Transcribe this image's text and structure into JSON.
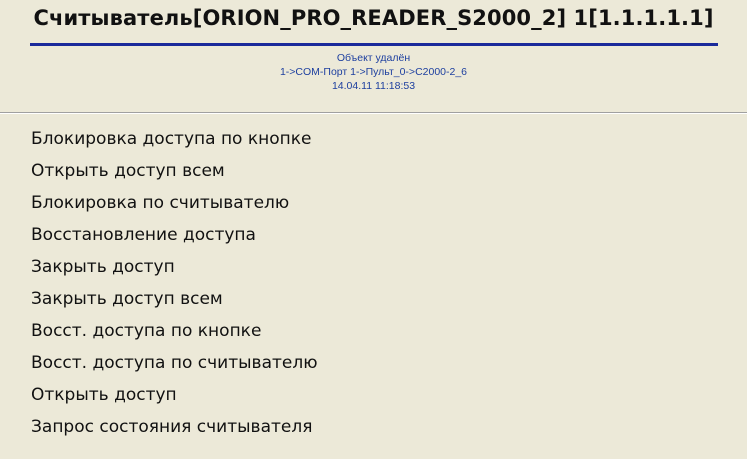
{
  "header": {
    "title": "Считыватель[ORION_PRO_READER_S2000_2] 1[1.1.1.1.1]",
    "status": "Объект удалён",
    "path": "1->COM-Порт 1->Пульт_0->С2000-2_6",
    "timestamp": "14.04.11 11:18:53"
  },
  "menu": {
    "items": [
      {
        "label": "Блокировка доступа по кнопке"
      },
      {
        "label": "Открыть доступ всем"
      },
      {
        "label": "Блокировка по считывателю"
      },
      {
        "label": "Восстановление доступа"
      },
      {
        "label": "Закрыть доступ"
      },
      {
        "label": "Закрыть доступ всем"
      },
      {
        "label": "Восст. доступа по кнопке"
      },
      {
        "label": "Восст. доступа по считывателю"
      },
      {
        "label": "Открыть доступ"
      },
      {
        "label": "Запрос состояния считывателя"
      }
    ]
  },
  "colors": {
    "background": "#ece9d8",
    "title_underline": "#1a2a9b",
    "info_text": "#1d3f9f"
  }
}
